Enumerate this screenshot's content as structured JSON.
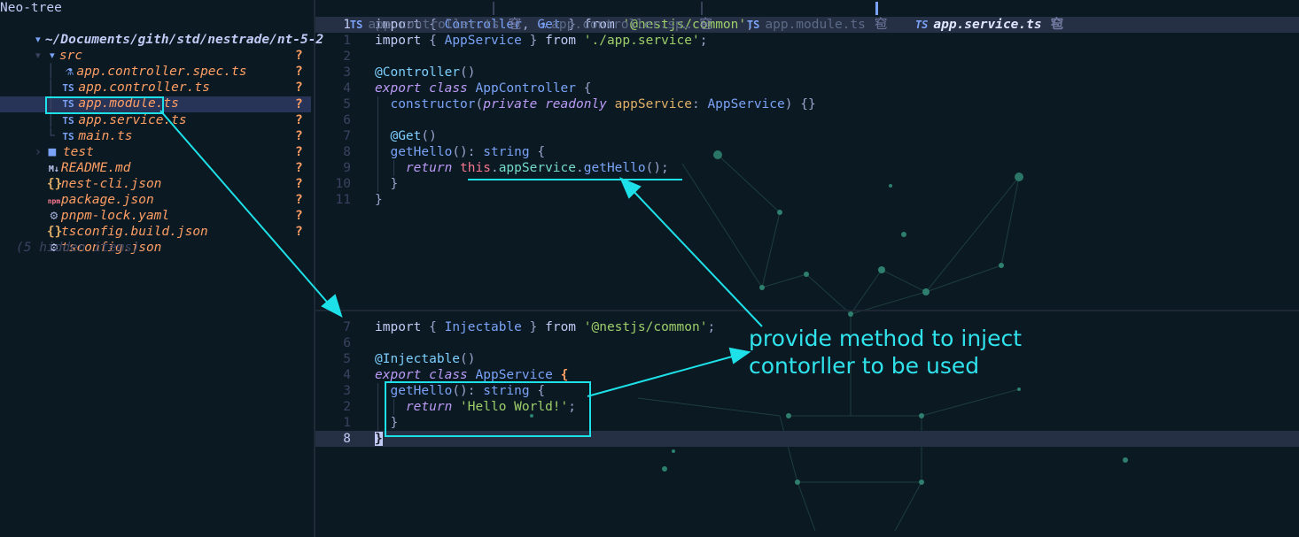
{
  "sidebar": {
    "title": "Neo-tree",
    "root_path": "~/Documents/gith/std/nestrade/nt-5-2",
    "src_folder": "src",
    "src_files": [
      {
        "name": "app.controller.spec.ts",
        "icon": "flask-icon",
        "status": "?"
      },
      {
        "name": "app.controller.ts",
        "icon": "ts-icon",
        "status": "?"
      },
      {
        "name": "app.module.ts",
        "icon": "ts-icon",
        "status": "?"
      },
      {
        "name": "app.service.ts",
        "icon": "ts-icon",
        "status": "?"
      },
      {
        "name": "main.ts",
        "icon": "ts-icon",
        "status": "?"
      }
    ],
    "root_items": [
      {
        "name": "test",
        "icon": "folder-icon",
        "status": "?"
      },
      {
        "name": "README.md",
        "icon": "markdown-icon",
        "status": "?"
      },
      {
        "name": "nest-cli.json",
        "icon": "json-icon",
        "status": "?"
      },
      {
        "name": "package.json",
        "icon": "npm-icon",
        "status": "?"
      },
      {
        "name": "pnpm-lock.yaml",
        "icon": "gear-icon",
        "status": "?"
      },
      {
        "name": "tsconfig.json",
        "icon": "config-icon",
        "status": "?"
      }
    ],
    "tsconfig_build": {
      "name": "tsconfig.build.json",
      "icon": "json-icon",
      "status": "?"
    },
    "hidden_items": "(5 hidden items)",
    "ts_glyph": "TS"
  },
  "tabs": [
    {
      "label": "app.controller.ts",
      "icon": "TS",
      "close": "窇"
    },
    {
      "label": "app.controller.sp…",
      "icon": "flask",
      "close": "窇"
    },
    {
      "label": "app.module.ts",
      "icon": "TS",
      "close": "窇"
    },
    {
      "label": "app.service.ts",
      "icon": "TS",
      "close": "窇",
      "active": true
    }
  ],
  "top_pane": {
    "line_numbers": [
      "1",
      "1",
      "2",
      "3",
      "4",
      "5",
      "6",
      "7",
      "8",
      "9",
      "10",
      "11"
    ],
    "tokens": {
      "import": "import",
      "from": "from",
      "export": "export",
      "class": "class",
      "private": "private",
      "readonly": "readonly",
      "return": "return",
      "this": "this",
      "controller": "Controller",
      "get": "Get",
      "common": "'@nestjs/common'",
      "appservice": "AppService",
      "appservice_path": "'./app.service'",
      "dec_controller": "@Controller",
      "appcontroller": "AppController",
      "constructor": "constructor",
      "appservice_prop": "appService",
      "dec_get": "@Get",
      "gethello": "getHello",
      "string": "string"
    }
  },
  "bottom_pane": {
    "line_numbers": [
      "7",
      "6",
      "5",
      "4",
      "3",
      "2",
      "1",
      "8"
    ],
    "tokens": {
      "injectable": "Injectable",
      "dec_injectable": "@Injectable",
      "hello_world": "'Hello World!'"
    }
  },
  "annotation": {
    "text_line1": "provide method to inject",
    "text_line2": "contorller to be used"
  },
  "colors": {
    "accent": "#1ee0e8",
    "modified": "#ff9e64",
    "keyword": "#bb9af7",
    "string": "#9ece6a"
  }
}
